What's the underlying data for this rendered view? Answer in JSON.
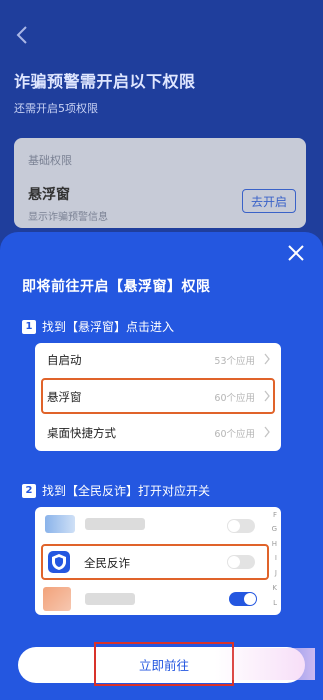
{
  "background": {
    "title": "诈骗预警需开启以下权限",
    "subtitle": "还需开启5项权限",
    "card": {
      "section": "基础权限",
      "name": "悬浮窗",
      "description": "显示诈骗预警信息",
      "action": "去开启"
    }
  },
  "sheet": {
    "title": "即将前往开启【悬浮窗】权限",
    "step1": {
      "num": "1",
      "text": "找到【悬浮窗】点击进入"
    },
    "list1": [
      {
        "label": "自启动",
        "count": "53个应用"
      },
      {
        "label": "悬浮窗",
        "count": "60个应用"
      },
      {
        "label": "桌面快捷方式",
        "count": "60个应用"
      }
    ],
    "step2": {
      "num": "2",
      "text": "找到【全民反诈】打开对应开关"
    },
    "list2": {
      "app_name": "全民反诈",
      "index_letters": [
        "F",
        "G",
        "H",
        "I",
        "J",
        "K",
        "L"
      ]
    },
    "go_button": "立即前往"
  },
  "colors": {
    "sheet": "#2457e0",
    "highlight": "#e0632a",
    "toggle_on": "#2457e0"
  },
  "icons": [
    "chevron-left-icon",
    "close-icon",
    "chevron-right-icon",
    "shield-icon"
  ]
}
